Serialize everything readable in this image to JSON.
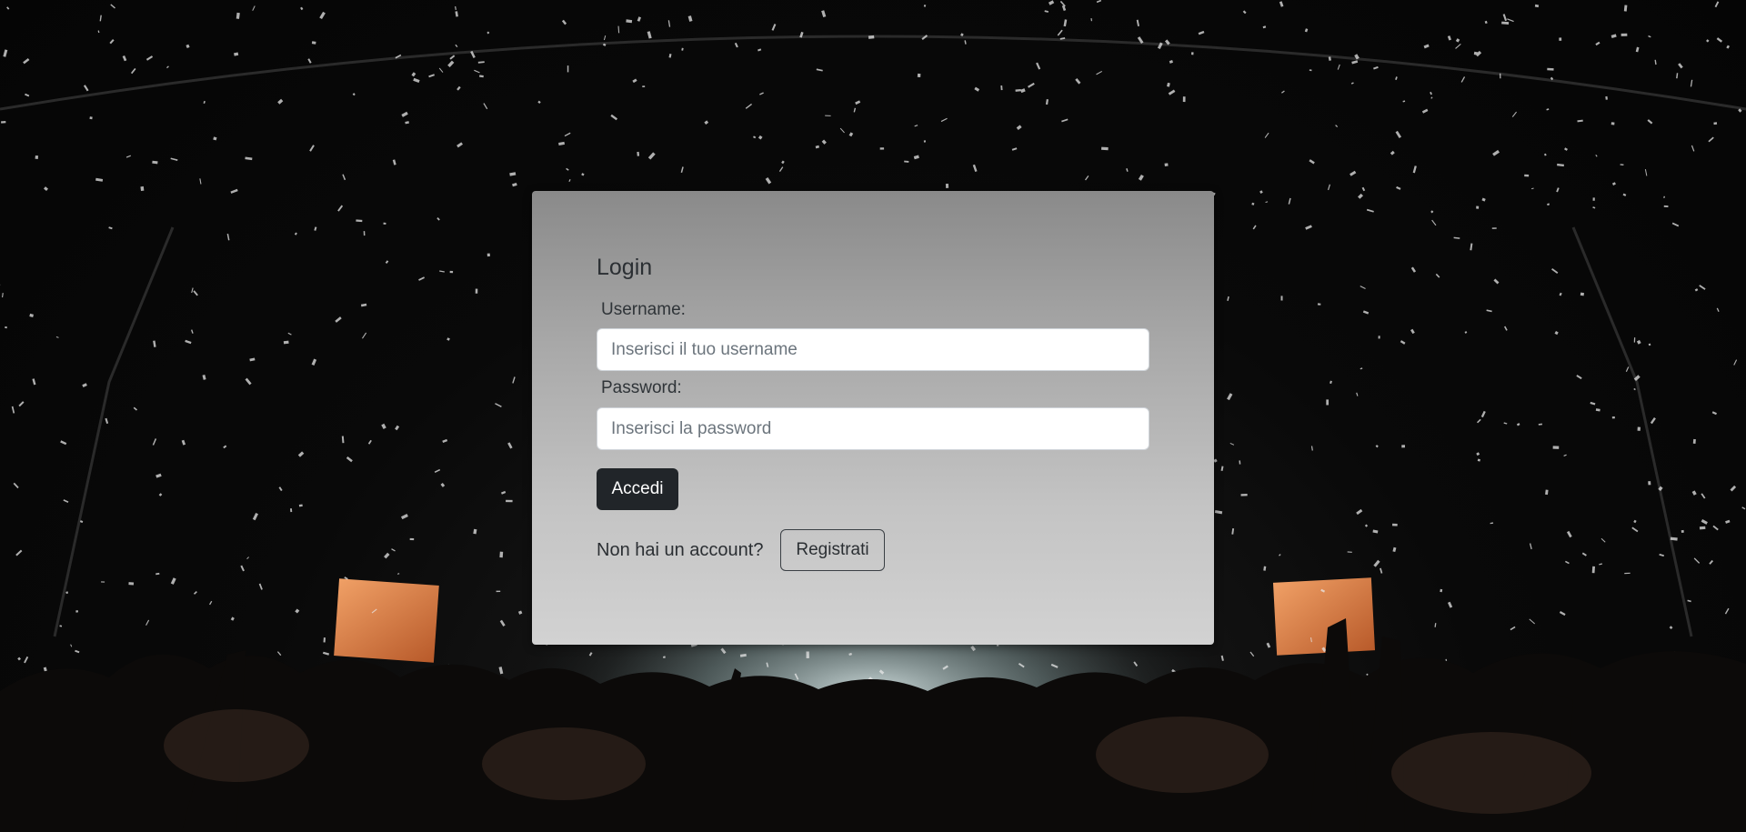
{
  "login": {
    "title": "Login",
    "username_label": "Username:",
    "username_placeholder": "Inserisci il tuo username",
    "username_value": "",
    "password_label": "Password:",
    "password_placeholder": "Inserisci la password",
    "password_value": "",
    "submit_label": "Accedi",
    "register_prompt": "Non hai un account?",
    "register_label": "Registrati"
  },
  "colors": {
    "primary_button": "#212529",
    "card_top": "#8a8a8a",
    "card_bottom": "#d2d2d2",
    "page_background": "#090909"
  }
}
